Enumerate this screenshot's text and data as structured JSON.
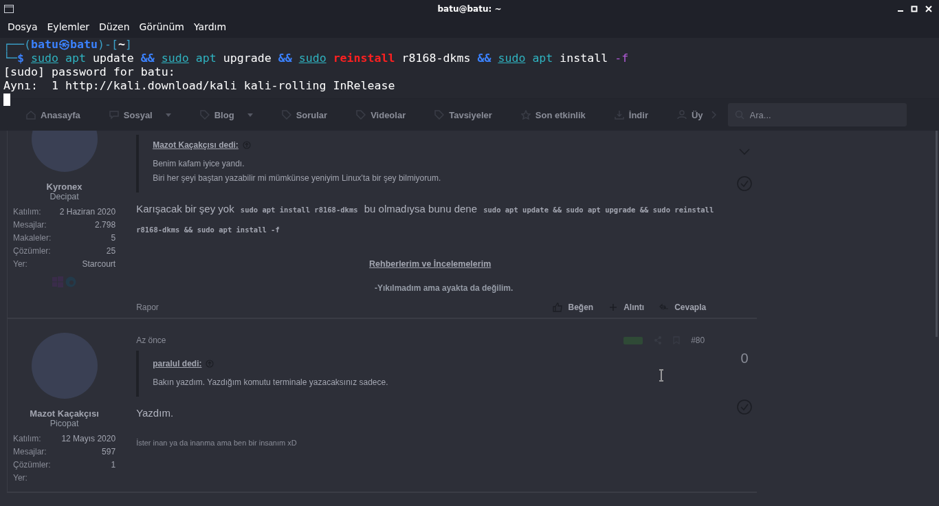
{
  "terminal": {
    "title": "batu@batu: ~",
    "menu": [
      "Dosya",
      "Eylemler",
      "Düzen",
      "Görünüm",
      "Yardım"
    ],
    "lines": [
      [
        {
          "kind": "frame",
          "text": "┌──("
        },
        {
          "kind": "host",
          "text": "batu㉿batu"
        },
        {
          "kind": "frame",
          "text": ")-["
        },
        {
          "kind": "path",
          "text": "~"
        },
        {
          "kind": "frame",
          "text": "]"
        }
      ],
      [
        {
          "kind": "frame",
          "text": "└─"
        },
        {
          "kind": "prompt",
          "text": "$ "
        },
        {
          "kind": "sudo",
          "text": "sudo"
        },
        {
          "kind": "cmd",
          "text": " apt"
        },
        {
          "kind": "plain",
          "text": " update "
        },
        {
          "kind": "op",
          "text": "&& "
        },
        {
          "kind": "sudo",
          "text": "sudo"
        },
        {
          "kind": "cmd",
          "text": " apt"
        },
        {
          "kind": "plain",
          "text": " upgrade "
        },
        {
          "kind": "op",
          "text": "&& "
        },
        {
          "kind": "sudo",
          "text": "sudo"
        },
        {
          "kind": "bad",
          "text": " reinstall"
        },
        {
          "kind": "plain",
          "text": " r8168-dkms "
        },
        {
          "kind": "op",
          "text": "&& "
        },
        {
          "kind": "sudo",
          "text": "sudo"
        },
        {
          "kind": "cmd",
          "text": " apt"
        },
        {
          "kind": "plain",
          "text": " install "
        },
        {
          "kind": "opt",
          "text": "-f"
        }
      ],
      [
        {
          "kind": "plain",
          "text": "[sudo] password for batu:"
        }
      ],
      [
        {
          "kind": "plain",
          "text": "Aynı:  1 http://kali.download/kali kali-rolling InRelease"
        }
      ]
    ]
  },
  "browser": {
    "nav": [
      {
        "kind": "home",
        "label": "Anasayfa",
        "caret": false
      },
      {
        "kind": "chat",
        "label": "Sosyal",
        "caret": true
      },
      {
        "kind": "tag",
        "label": "Blog",
        "caret": true
      },
      {
        "kind": "tag",
        "label": "Sorular",
        "caret": false
      },
      {
        "kind": "tag",
        "label": "Videolar",
        "caret": false
      },
      {
        "kind": "tag",
        "label": "Tavsiyeler",
        "caret": false
      },
      {
        "kind": "star",
        "label": "Son etkinlik",
        "caret": false
      },
      {
        "kind": "download",
        "label": "İndir",
        "caret": false
      },
      {
        "kind": "user",
        "label": "Üy",
        "caret": false
      }
    ],
    "search": {
      "placeholder": "Ara..."
    },
    "posts": [
      {
        "user": {
          "name": "Kyronex",
          "rank": "Decipat",
          "stats": [
            {
              "label": "Katılım:",
              "value": "2 Haziran 2020"
            },
            {
              "label": "Mesajlar:",
              "value": "2.798"
            },
            {
              "label": "Makaleler:",
              "value": "5"
            },
            {
              "label": "Çözümler:",
              "value": "25"
            },
            {
              "label": "Yer:",
              "value": "Starcourt"
            }
          ],
          "badges": true
        },
        "quote": {
          "author": "Mazot Kaçakçısı dedi:",
          "lines": [
            "Benim kafam iyice yandı.",
            "Biri her şeyi baştan yazabilir mi mümkünse yeniyim Linux'ta bir şey bilmiyorum."
          ]
        },
        "body": [
          {
            "kind": "text",
            "text": "Karışacak bir şey yok "
          },
          {
            "kind": "code",
            "text": "sudo apt install r8168-dkms"
          },
          {
            "kind": "text",
            "text": " bu olmadıysa bunu dene "
          },
          {
            "kind": "code",
            "text": "sudo apt update && sudo apt upgrade && sudo reinstall r8168-dkms && sudo apt install -f"
          }
        ],
        "signature_link": "Rehberlerim ve İncelemelerim",
        "signature": "-Yıkılmadım ama ayakta da değilim.",
        "report": "Rapor",
        "actions": [
          "Beğen",
          "Alıntı",
          "Cevapla"
        ],
        "vote": {
          "chevron": true
        }
      },
      {
        "time": "Az önce",
        "number": "#80",
        "user": {
          "name": "Mazot Kaçakçısı",
          "rank": "Picopat",
          "stats": [
            {
              "label": "Katılım:",
              "value": "12 Mayıs 2020"
            },
            {
              "label": "Mesajlar:",
              "value": "597"
            },
            {
              "label": "Çözümler:",
              "value": "1"
            },
            {
              "label": "Yer:"
            }
          ],
          "badges": false
        },
        "quote": {
          "author": "paralul dedi:",
          "lines": [
            "Bakın yazdım. Yazdığım komutu terminale yazacaksınız sadece."
          ]
        },
        "body": [
          {
            "kind": "text",
            "text": "Yazdım."
          }
        ],
        "signature": "İster inan ya da inanma ama ben bir insanım xD",
        "vote": {
          "score": "0"
        }
      }
    ]
  }
}
